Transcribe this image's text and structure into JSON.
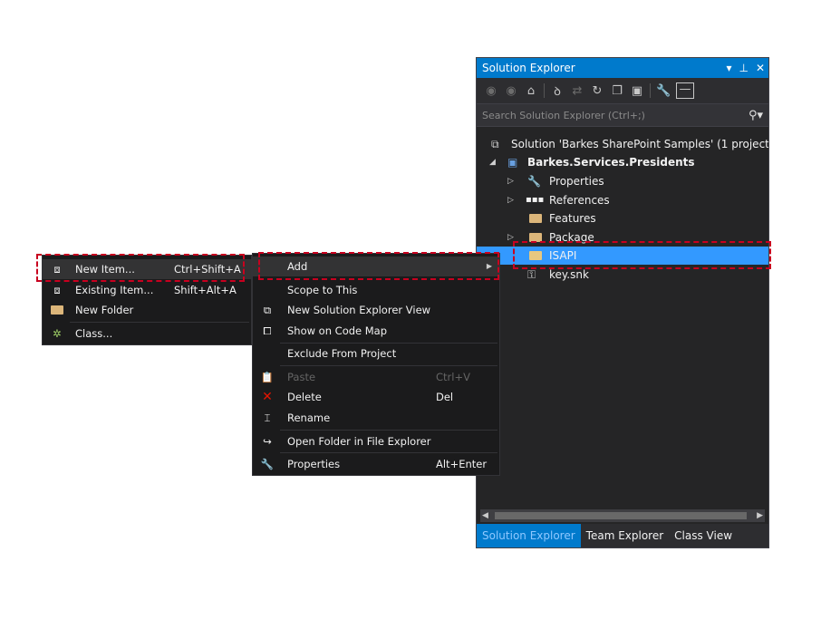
{
  "solution_explorer": {
    "title": "Solution Explorer",
    "title_buttons": [
      "▾",
      "⊥",
      "✕"
    ],
    "search_placeholder": "Search Solution Explorer (Ctrl+;)",
    "tree": [
      {
        "label": "Solution 'Barkes SharePoint Samples' (1 project",
        "icon": "solution-icon"
      },
      {
        "label": "Barkes.Services.Presidents",
        "icon": "project-icon",
        "expanded": true
      },
      {
        "label": "Properties",
        "icon": "wrench-icon"
      },
      {
        "label": "References",
        "icon": "references-icon"
      },
      {
        "label": "Features",
        "icon": "folder-icon"
      },
      {
        "label": "Package",
        "icon": "folder-icon"
      },
      {
        "label": "ISAPI",
        "icon": "folder-icon",
        "selected": true
      },
      {
        "label": "key.snk",
        "icon": "key-icon"
      }
    ],
    "tabs": [
      "Solution Explorer",
      "Team Explorer",
      "Class View"
    ]
  },
  "context_menu": {
    "items": [
      {
        "label": "Add",
        "shortcut": "",
        "icon": ""
      },
      {
        "label": "Scope to This",
        "shortcut": "",
        "icon": ""
      },
      {
        "label": "New Solution Explorer View",
        "shortcut": "",
        "icon": "new-view-icon"
      },
      {
        "label": "Show on Code Map",
        "shortcut": "",
        "icon": "code-map-icon"
      },
      {
        "label": "Exclude From Project",
        "shortcut": "",
        "icon": ""
      },
      {
        "label": "Paste",
        "shortcut": "Ctrl+V",
        "icon": "paste-icon",
        "disabled": true
      },
      {
        "label": "Delete",
        "shortcut": "Del",
        "icon": "delete-icon"
      },
      {
        "label": "Rename",
        "shortcut": "",
        "icon": "rename-icon"
      },
      {
        "label": "Open Folder in File Explorer",
        "shortcut": "",
        "icon": "open-folder-icon"
      },
      {
        "label": "Properties",
        "shortcut": "Alt+Enter",
        "icon": "wrench-icon"
      }
    ]
  },
  "add_submenu": {
    "items": [
      {
        "label": "New Item...",
        "shortcut": "Ctrl+Shift+A",
        "icon": "new-item-icon"
      },
      {
        "label": "Existing Item...",
        "shortcut": "Shift+Alt+A",
        "icon": "existing-item-icon"
      },
      {
        "label": "New Folder",
        "shortcut": "",
        "icon": "folder-icon"
      },
      {
        "label": "Class...",
        "shortcut": "",
        "icon": "class-icon"
      }
    ]
  },
  "colors": {
    "accent": "#007acc",
    "selection": "#3399ff",
    "highlight_box": "#c8001f"
  }
}
